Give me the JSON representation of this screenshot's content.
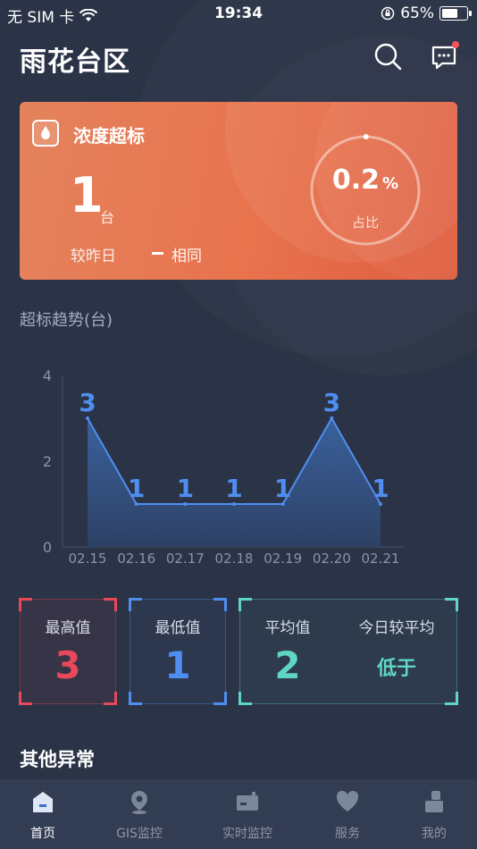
{
  "status_bar": {
    "carrier": "无 SIM 卡",
    "time": "19:34",
    "battery_percent": "65%",
    "battery_level": 0.65
  },
  "header": {
    "title": "雨花台区",
    "icons": [
      "search-icon",
      "message-icon"
    ],
    "badge_color": "#f2555a"
  },
  "alert_card": {
    "icon": "fire-drop-icon",
    "title": "浓度超标",
    "count": "1",
    "unit": "台",
    "compare_label": "较昨日",
    "compare_value": "相同",
    "ratio_value": "0.2",
    "ratio_unit": "%",
    "ratio_label": "占比",
    "ratio_fraction": 0.002
  },
  "trend": {
    "section_title": "超标趋势(台)"
  },
  "chart_data": {
    "type": "area",
    "categories": [
      "02.15",
      "02.16",
      "02.17",
      "02.18",
      "02.19",
      "02.20",
      "02.21"
    ],
    "values": [
      3,
      1,
      1,
      1,
      1,
      3,
      1
    ],
    "data_labels": [
      "3",
      "1",
      "1",
      "1",
      "1",
      "3",
      "1"
    ],
    "yticks": [
      "0",
      "2",
      "4"
    ],
    "ylim": [
      0,
      4
    ],
    "grid": false,
    "line_color": "#4f8ef0"
  },
  "stats": {
    "max": {
      "label": "最高值",
      "value": "3",
      "color": "#e8485a"
    },
    "min": {
      "label": "最低值",
      "value": "1",
      "color": "#4f8ef0"
    },
    "avg": {
      "label": "平均值",
      "value": "2",
      "color": "#5fd6c4"
    },
    "today": {
      "label": "今日较平均",
      "value": "低于",
      "color": "#5fd6c4"
    }
  },
  "other": {
    "title": "其他异常"
  },
  "tabbar": {
    "active_color": "#ffffff",
    "items": [
      {
        "label": "首页",
        "icon": "home-icon",
        "active": true
      },
      {
        "label": "GIS监控",
        "icon": "location-pin-icon"
      },
      {
        "label": "实时监控",
        "icon": "monitor-device-icon"
      },
      {
        "label": "服务",
        "icon": "heart-icon"
      },
      {
        "label": "我的",
        "icon": "user-icon"
      }
    ]
  }
}
